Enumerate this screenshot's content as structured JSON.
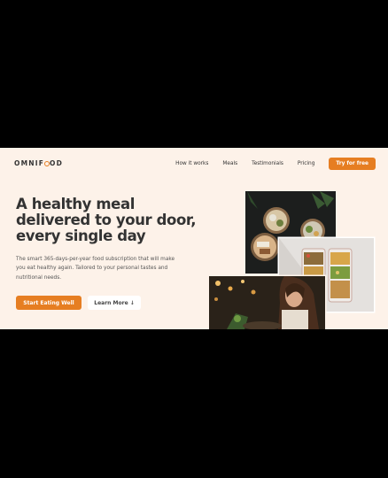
{
  "header": {
    "logo_left": "OMNIF",
    "logo_right": "OD",
    "nav": [
      "How it works",
      "Meals",
      "Testimonials",
      "Pricing"
    ],
    "cta": "Try for free"
  },
  "hero": {
    "headline": "A healthy meal delivered to your door, every single day",
    "description": "The smart 365-days-per-year food subscription that will make you eat healthy again. Tailored to your personal tastes and nutritional needs.",
    "primary_button": "Start Eating Well",
    "secondary_button": "Learn More ↓"
  },
  "colors": {
    "accent": "#e67e22",
    "background": "#fdf2e9",
    "text": "#333333"
  }
}
